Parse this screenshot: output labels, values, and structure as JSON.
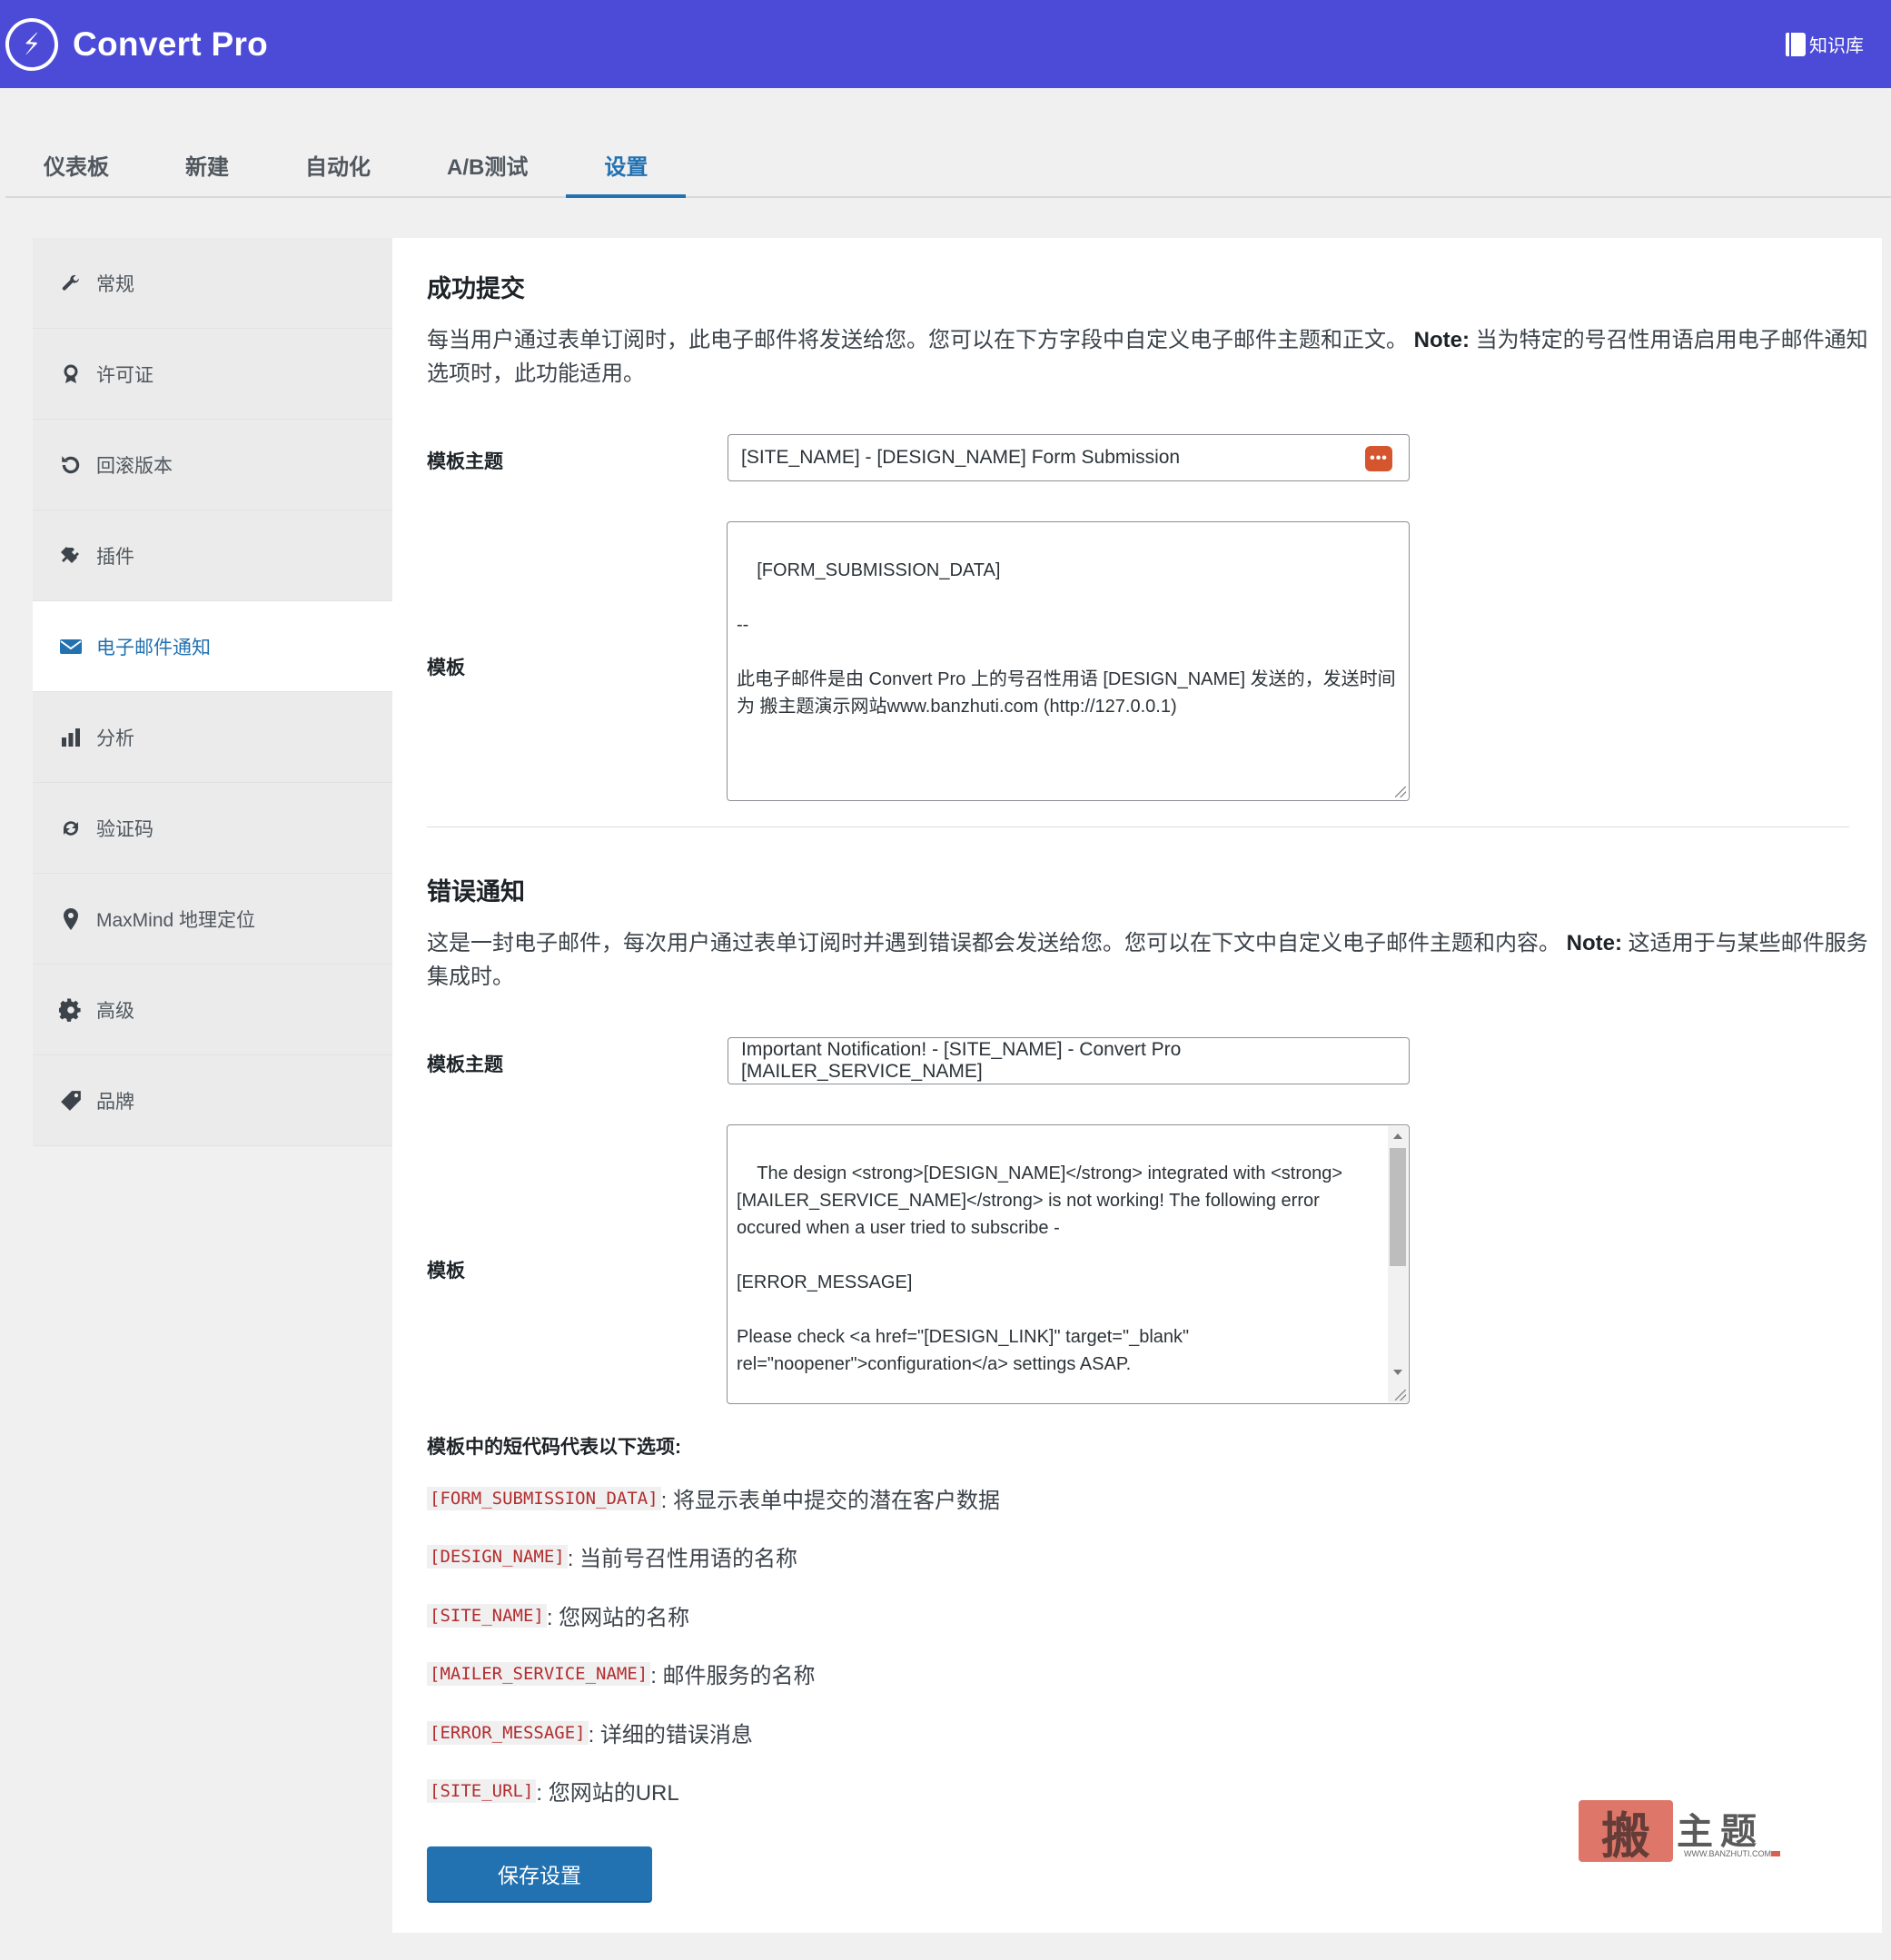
{
  "header": {
    "brand_logo_glyph": "⚡",
    "brand_name": "Convert Pro",
    "knowledge_base": "知识库",
    "bg_color": "#4c4bd8"
  },
  "tabs": [
    {
      "label": "仪表板",
      "active": false
    },
    {
      "label": "新建",
      "active": false
    },
    {
      "label": "自动化",
      "active": false
    },
    {
      "label": "A/B测试",
      "active": false
    },
    {
      "label": "设置",
      "active": true
    }
  ],
  "sidebar": {
    "items": [
      {
        "label": "常规",
        "icon": "wrench-icon"
      },
      {
        "label": "许可证",
        "icon": "award-icon"
      },
      {
        "label": "回滚版本",
        "icon": "undo-icon"
      },
      {
        "label": "插件",
        "icon": "plug-icon"
      },
      {
        "label": "电子邮件通知",
        "icon": "email-icon",
        "active": true
      },
      {
        "label": "分析",
        "icon": "bar-chart-icon"
      },
      {
        "label": "验证码",
        "icon": "refresh-icon"
      },
      {
        "label": "MaxMind 地理定位",
        "icon": "location-pin-icon"
      },
      {
        "label": "高级",
        "icon": "gear-icon"
      },
      {
        "label": "品牌",
        "icon": "tag-icon"
      }
    ]
  },
  "success": {
    "title": "成功提交",
    "desc_text": "每当用户通过表单订阅时，此电子邮件将发送给您。您可以在下方字段中自定义电子邮件主题和正文。 ",
    "desc_note_label": "Note:",
    "desc_note_text": " 当为特定的号召性用语启用电子邮件通知选项时，此功能适用。",
    "subject_label": "模板主题",
    "subject_value": "[SITE_NAME] - [DESIGN_NAME] Form Submission",
    "template_label": "模板",
    "template_value": "[FORM_SUBMISSION_DATA]\n\n--\n\n此电子邮件是由 Convert Pro 上的号召性用语 [DESIGN_NAME] 发送的，发送时间为 搬主题演示网站www.banzhuti.com (http://127.0.0.1)"
  },
  "error": {
    "title": "错误通知",
    "desc_text": "这是一封电子邮件，每次用户通过表单订阅时并遇到错误都会发送给您。您可以在下文中自定义电子邮件主题和内容。 ",
    "desc_note_label": "Note:",
    "desc_note_text": " 这适用于与某些邮件服务集成时。",
    "subject_label": "模板主题",
    "subject_value": "Important Notification! - [SITE_NAME] - Convert Pro [MAILER_SERVICE_NAME]",
    "template_label": "模板",
    "template_value": "The design <strong>[DESIGN_NAME]</strong> integrated with <strong>[MAILER_SERVICE_NAME]</strong> is not working! The following error occured when a user tried to subscribe -\n\n[ERROR_MESSAGE]\n\nPlease check <a href=\"[DESIGN_LINK]\" target=\"_blank\" rel=\"noopener\">configuration</a> settings ASAP.\n\n -----"
  },
  "shortcodes": {
    "title": "模板中的短代码代表以下选项:",
    "items": [
      {
        "code": "[FORM_SUBMISSION_DATA]",
        "desc": " : 将显示表单中提交的潜在客户数据"
      },
      {
        "code": "[DESIGN_NAME]",
        "desc": " : 当前号召性用语的名称"
      },
      {
        "code": "[SITE_NAME]",
        "desc": " : 您网站的名称"
      },
      {
        "code": "[MAILER_SERVICE_NAME]",
        "desc": " : 邮件服务的名称"
      },
      {
        "code": "[ERROR_MESSAGE]",
        "desc": " : 详细的错误消息"
      },
      {
        "code": "[SITE_URL]",
        "desc": " : 您网站的URL"
      }
    ]
  },
  "save_button": "保存设置",
  "watermark": {
    "seal": "搬",
    "text": "主题",
    "url": "WWW.BANZHUTI.COM"
  },
  "colors": {
    "accent": "#2271b1",
    "shortcode": "#b32d2e",
    "badge": "#d4552e"
  }
}
